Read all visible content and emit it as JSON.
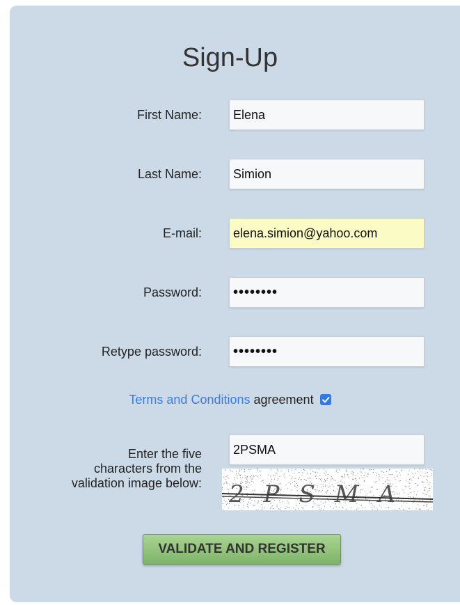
{
  "form": {
    "title": "Sign-Up",
    "fields": {
      "first_name": {
        "label": "First Name:",
        "value": "Elena"
      },
      "last_name": {
        "label": "Last Name:",
        "value": "Simion"
      },
      "email": {
        "label": "E-mail:",
        "value": "elena.simion@yahoo.com"
      },
      "password": {
        "label": "Password:",
        "value": "••••••••"
      },
      "retype_password": {
        "label": "Retype password:",
        "value": "••••••••"
      }
    },
    "terms": {
      "link_text": "Terms and Conditions",
      "suffix_text": "agreement",
      "checked": true
    },
    "captcha": {
      "label_line1": "Enter the five",
      "label_line2": "characters from the",
      "label_line3": "validation image below:",
      "value": "2PSMA",
      "image_text": "2PSMA"
    },
    "submit_label": "VALIDATE AND REGISTER"
  },
  "colors": {
    "panel_bg": "#ccdae8",
    "autofill_bg": "#fbfbc6",
    "link": "#3b7ddd",
    "button": "#8fc278"
  }
}
